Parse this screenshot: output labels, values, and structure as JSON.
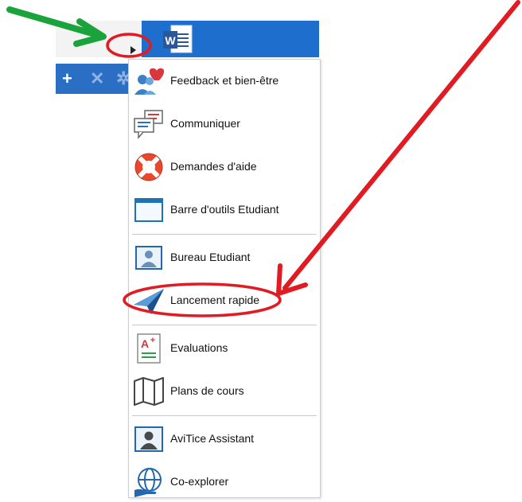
{
  "menu": {
    "items": [
      {
        "label": "Feedback et bien-être",
        "icon": "feedback-heart-icon"
      },
      {
        "label": "Communiquer",
        "icon": "chat-bubbles-icon"
      },
      {
        "label": "Demandes d'aide",
        "icon": "lifebuoy-icon"
      },
      {
        "label": "Barre d'outils Etudiant",
        "icon": "toolbar-window-icon"
      },
      {
        "label": "Bureau Etudiant",
        "icon": "student-desktop-icon"
      },
      {
        "label": "Lancement rapide",
        "icon": "paper-plane-icon"
      },
      {
        "label": "Evaluations",
        "icon": "grade-a-plus-icon"
      },
      {
        "label": "Plans de cours",
        "icon": "map-icon"
      },
      {
        "label": "AviTice Assistant",
        "icon": "assistant-icon"
      },
      {
        "label": "Co-explorer",
        "icon": "globe-hand-icon"
      }
    ]
  },
  "topbar": {
    "app_icon": "word-document-icon",
    "expand_icon": "expand-arrow-icon",
    "toolbar_icons": [
      "plus-icon",
      "close-icon",
      "gear-icon"
    ]
  },
  "colors": {
    "blue": "#1e6fcd",
    "annotation_red": "#e11b22",
    "annotation_green": "#1aa33a"
  }
}
